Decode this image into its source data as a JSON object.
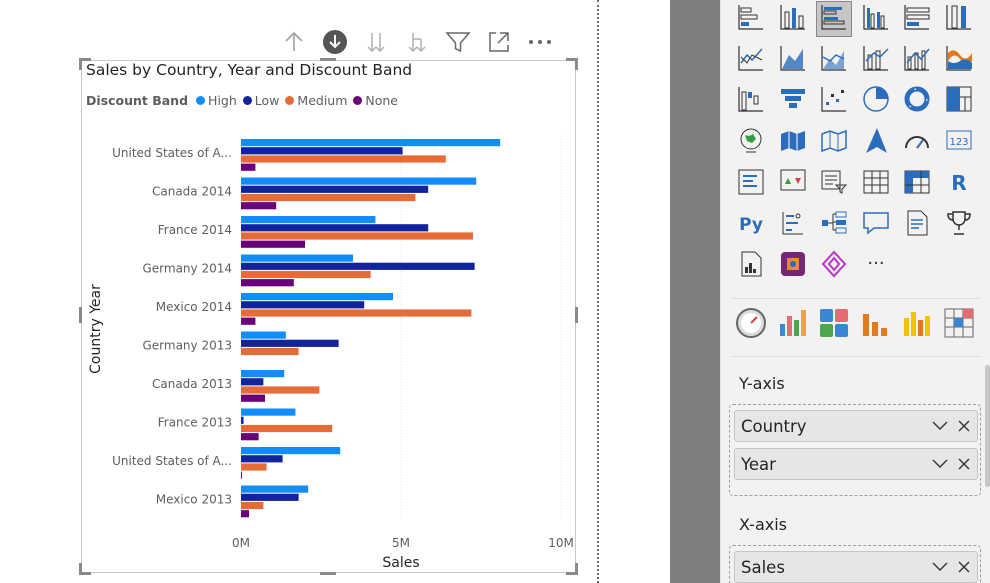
{
  "canvas": {
    "visual_header_icons": [
      "up-arrow-icon",
      "drill-down-active-icon",
      "next-level-icon",
      "expand-hierarchy-icon",
      "filter-icon",
      "focus-mode-icon",
      "more-options-icon"
    ]
  },
  "colors": {
    "High": "#118dff",
    "Low": "#12239e",
    "Medium": "#e66c37",
    "None": "#6b007b",
    "grid": "#e1dfdd",
    "text": "#605e5c"
  },
  "legend": {
    "title": "Discount Band",
    "items": [
      "High",
      "Low",
      "Medium",
      "None"
    ]
  },
  "chart_data": {
    "type": "bar",
    "orientation": "horizontal",
    "title": "Sales by Country, Year and Discount Band",
    "xlabel": "Sales",
    "ylabel": "Country Year",
    "xlim": [
      0,
      10000000
    ],
    "xticks": [
      0,
      5000000,
      10000000
    ],
    "xtick_labels": [
      "0M",
      "5M",
      "10M"
    ],
    "grid": "vertical dotted",
    "legend_position": "top-left",
    "categories": [
      "United States of A...",
      "Canada 2014",
      "France 2014",
      "Germany 2014",
      "Mexico 2014",
      "Germany 2013",
      "Canada 2013",
      "France 2013",
      "United States of A...",
      "Mexico 2013"
    ],
    "series": [
      {
        "name": "High",
        "values": [
          8100000,
          7350000,
          4200000,
          3500000,
          4750000,
          1400000,
          1350000,
          1700000,
          3100000,
          2100000
        ]
      },
      {
        "name": "Low",
        "values": [
          5050000,
          5850000,
          5850000,
          7300000,
          3850000,
          3050000,
          700000,
          80000,
          1300000,
          1800000
        ]
      },
      {
        "name": "Medium",
        "values": [
          6400000,
          5450000,
          7250000,
          4050000,
          7200000,
          1800000,
          2450000,
          2850000,
          800000,
          700000
        ]
      },
      {
        "name": "None",
        "values": [
          450000,
          1100000,
          2000000,
          1650000,
          450000,
          0,
          750000,
          550000,
          30000,
          250000
        ]
      }
    ]
  },
  "panel": {
    "visual_icons": [
      "stacked-bar-chart-icon",
      "stacked-column-chart-icon",
      "clustered-bar-chart-icon",
      "clustered-column-chart-icon",
      "100-stacked-bar-chart-icon",
      "100-stacked-column-chart-icon",
      "line-chart-icon",
      "area-chart-icon",
      "stacked-area-chart-icon",
      "line-stacked-column-icon",
      "line-clustered-column-icon",
      "ribbon-chart-icon",
      "waterfall-chart-icon",
      "funnel-chart-icon",
      "scatter-chart-icon",
      "pie-chart-icon",
      "donut-chart-icon",
      "treemap-icon",
      "map-icon",
      "filled-map-icon",
      "shape-map-icon",
      "azure-map-icon",
      "gauge-icon",
      "card-icon",
      "multi-row-card-icon",
      "kpi-icon",
      "slicer-icon",
      "table-icon",
      "matrix-icon",
      "r-visual-icon",
      "python-visual-icon",
      "key-influencers-icon",
      "decomposition-tree-icon",
      "qa-icon",
      "smart-narrative-icon",
      "goals-icon",
      "paginated-report-icon",
      "power-apps-icon",
      "power-automate-icon",
      "more-visuals-icon"
    ],
    "custom_icons": [
      "custom-gauge-icon",
      "custom-column-icon",
      "custom-tiles-icon",
      "custom-bars-icon",
      "custom-waterfall-icon",
      "custom-grid-icon"
    ],
    "sections": [
      {
        "label": "Y-axis",
        "fields": [
          "Country",
          "Year"
        ]
      },
      {
        "label": "X-axis",
        "fields": [
          "Sales"
        ]
      }
    ],
    "ellipsis": "···",
    "r_label": "R",
    "py_label": "Py",
    "card_label": "123"
  }
}
